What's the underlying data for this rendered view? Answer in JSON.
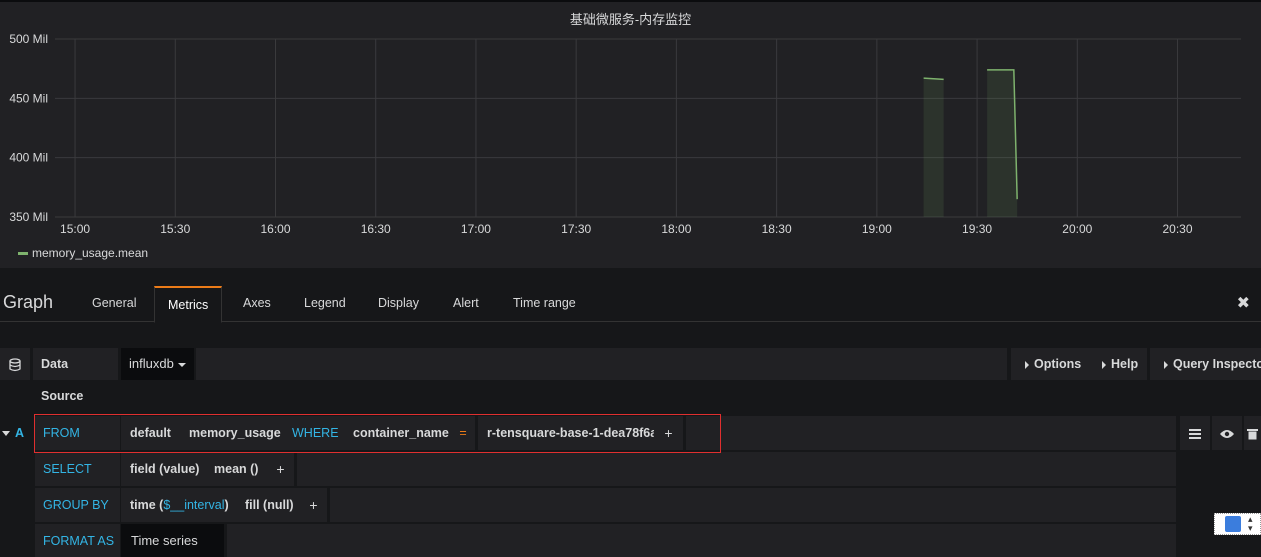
{
  "graph": {
    "title": "基础微服务-内存监控",
    "legend": {
      "series_name": "memory_usage.mean",
      "color": "#7eb26d"
    }
  },
  "chart_data": {
    "type": "line",
    "title": "基础微服务-内存监控",
    "xlabel": "",
    "ylabel": "",
    "x_ticks": [
      "15:00",
      "15:30",
      "16:00",
      "16:30",
      "17:00",
      "17:30",
      "18:00",
      "18:30",
      "19:00",
      "19:30",
      "20:00",
      "20:30"
    ],
    "y_ticks": [
      "500 Mil",
      "450 Mil",
      "400 Mil",
      "350 Mil"
    ],
    "ylim": [
      350,
      500
    ],
    "xlim": [
      "14:54",
      "20:49"
    ],
    "grid": true,
    "series": [
      {
        "name": "memory_usage.mean",
        "color": "#7eb26d",
        "fill": true,
        "segments": [
          {
            "points": [
              [
                "19:14",
                467
              ],
              [
                "19:20",
                466
              ]
            ]
          },
          {
            "points": [
              [
                "19:33",
                474
              ],
              [
                "19:41",
                474
              ],
              [
                "19:42",
                365
              ]
            ]
          }
        ]
      }
    ]
  },
  "editor": {
    "title": "Graph",
    "tabs": [
      {
        "label": "General"
      },
      {
        "label": "Metrics",
        "active": true
      },
      {
        "label": "Axes"
      },
      {
        "label": "Legend"
      },
      {
        "label": "Display"
      },
      {
        "label": "Alert"
      },
      {
        "label": "Time range"
      }
    ],
    "close_symbol": "✖"
  },
  "datasource": {
    "label": "Data Source",
    "value": "influxdb",
    "options_label": "Options",
    "help_label": "Help",
    "inspector_label": "Query Inspector"
  },
  "query": {
    "ref_id": "A",
    "from": {
      "keyword": "FROM",
      "policy": "default",
      "measurement": "memory_usage",
      "where": "WHERE",
      "tag_key": "container_name",
      "operator": "=",
      "tag_value": "r-tensquare-base-1-dea78f6a",
      "plus": "+"
    },
    "select": {
      "keyword": "SELECT",
      "field": "field (value)",
      "func": "mean ()",
      "plus": "+"
    },
    "group_by": {
      "keyword": "GROUP BY",
      "time_prefix": "time (",
      "time_var": "$__interval",
      "time_suffix": ")",
      "fill": "fill (null)",
      "plus": "+"
    },
    "format_as": {
      "keyword": "FORMAT AS",
      "value": "Time series"
    }
  }
}
